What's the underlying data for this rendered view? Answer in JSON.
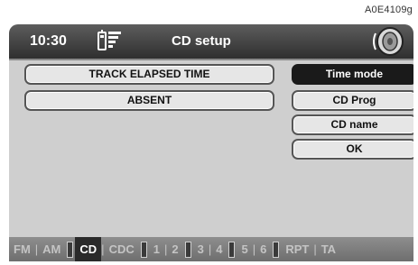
{
  "reference_code": "A0E4109g",
  "header": {
    "time": "10:30",
    "title": "CD setup"
  },
  "fields": [
    "TRACK ELAPSED TIME",
    "ABSENT"
  ],
  "softkeys": [
    {
      "label": "Time mode",
      "active": true
    },
    {
      "label": "CD Prog",
      "active": false
    },
    {
      "label": "CD name",
      "active": false
    },
    {
      "label": "OK",
      "active": false
    }
  ],
  "bottom_bar": [
    {
      "label": "FM",
      "active": false
    },
    {
      "label": "AM",
      "active": false
    },
    {
      "label": "CD",
      "active": true
    },
    {
      "label": "CDC",
      "active": false
    },
    {
      "label": "1",
      "active": false
    },
    {
      "label": "2",
      "active": false
    },
    {
      "label": "3",
      "active": false
    },
    {
      "label": "4",
      "active": false
    },
    {
      "label": "5",
      "active": false
    },
    {
      "label": "6",
      "active": false
    },
    {
      "label": "RPT",
      "active": false
    },
    {
      "label": "TA",
      "active": false
    }
  ]
}
